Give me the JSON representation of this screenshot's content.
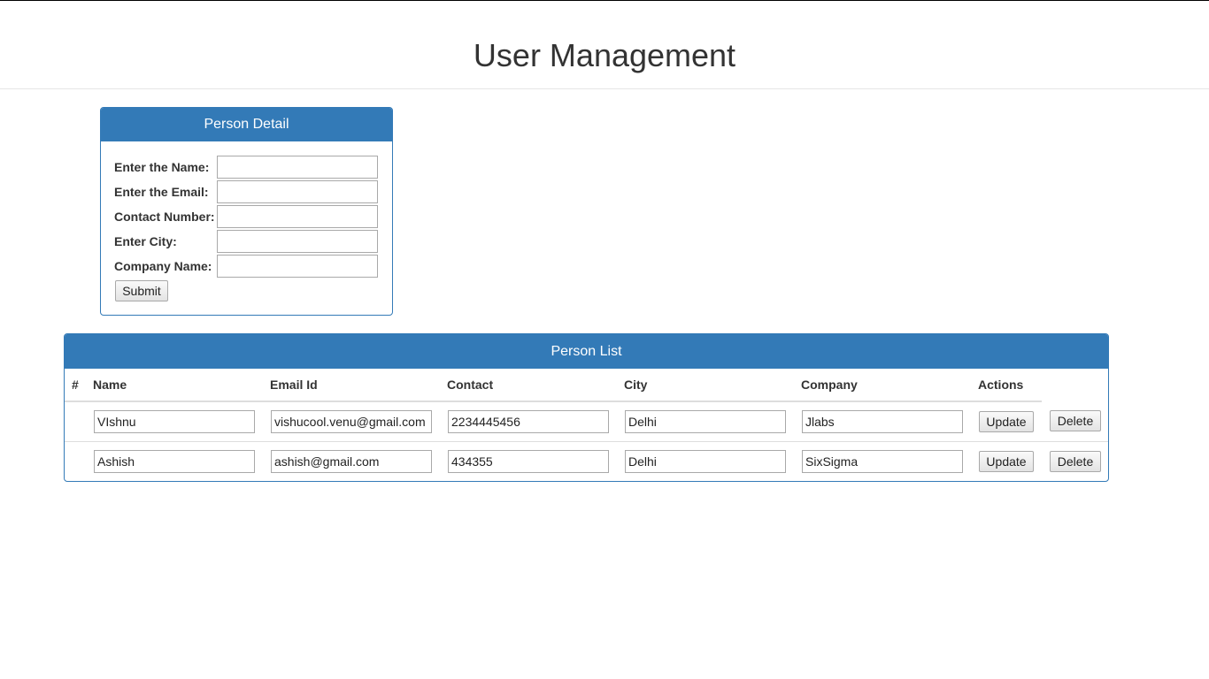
{
  "page": {
    "title": "User Management"
  },
  "detail_panel": {
    "heading": "Person Detail",
    "fields": [
      {
        "label": "Enter the Name:",
        "value": ""
      },
      {
        "label": "Enter the Email:",
        "value": ""
      },
      {
        "label": "Contact Number:",
        "value": ""
      },
      {
        "label": "Enter City:",
        "value": ""
      },
      {
        "label": "Company Name:",
        "value": ""
      }
    ],
    "submit_label": "Submit"
  },
  "list_panel": {
    "heading": "Person List",
    "columns": [
      "#",
      "Name",
      "Email Id",
      "Contact",
      "City",
      "Company",
      "Actions"
    ],
    "rows": [
      {
        "name": "VIshnu",
        "email": "vishucool.venu@gmail.com",
        "contact": "2234445456",
        "city": "Delhi",
        "company": "Jlabs"
      },
      {
        "name": "Ashish",
        "email": "ashish@gmail.com",
        "contact": "434355",
        "city": "Delhi",
        "company": "SixSigma"
      }
    ],
    "update_label": "Update",
    "delete_label": "Delete"
  },
  "colors": {
    "primary": "#337ab7",
    "border": "#a9a9a9",
    "divider": "#dddddd"
  }
}
